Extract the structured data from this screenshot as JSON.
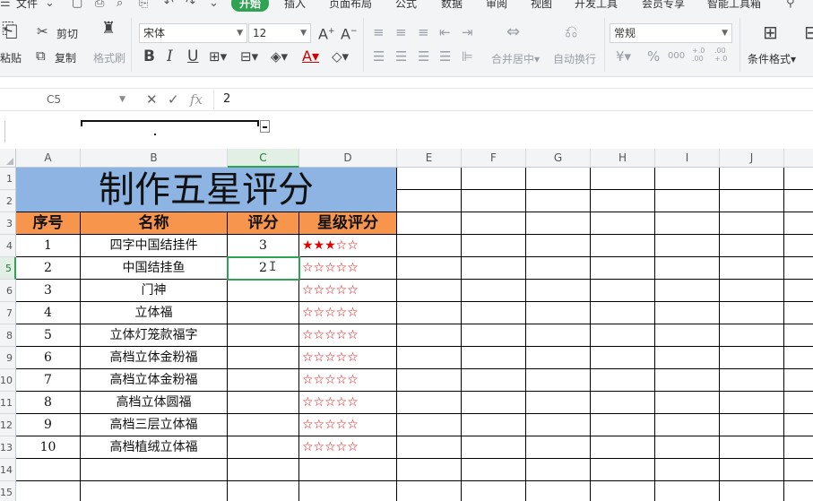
{
  "menu": {
    "file": "文件",
    "tabs": [
      "开始",
      "插入",
      "页面布局",
      "公式",
      "数据",
      "审阅",
      "视图",
      "开发工具",
      "会员专享",
      "智能工具箱"
    ],
    "active_tab": "开始"
  },
  "ribbon": {
    "paste": "粘贴",
    "cut": "剪切",
    "copy": "复制",
    "format_painter": "格式刷",
    "font_name": "宋体",
    "font_size": "12",
    "merge_center": "合并居中",
    "wrap_text": "自动换行",
    "number_format": "常规",
    "conditional_format": "条件格式",
    "currency_symbol": "¥",
    "percent_symbol": "%",
    "thousands": "000",
    "inc_decimal": "+.0 .00",
    "dec_decimal": ".00 +.0"
  },
  "formula_bar": {
    "name_box": "C5",
    "fx": "fx",
    "value": "2"
  },
  "sheet": {
    "columns": [
      "A",
      "B",
      "C",
      "D",
      "E",
      "F",
      "G",
      "H",
      "I",
      "J"
    ],
    "row_numbers": [
      "1",
      "2",
      "3",
      "4",
      "5",
      "6",
      "7",
      "8",
      "9",
      "10",
      "11",
      "12",
      "13",
      "14",
      "15"
    ],
    "selected_column": "C",
    "selected_row": "5",
    "title": "制作五星评分",
    "headers": [
      "序号",
      "名称",
      "评分",
      "星级评分"
    ],
    "rows": [
      {
        "no": "1",
        "name": "四字中国结挂件",
        "score": "3",
        "stars": "★★★☆☆",
        "filled_stars": 3
      },
      {
        "no": "2",
        "name": "中国结挂鱼",
        "score": "2",
        "stars": "☆☆☆☆☆",
        "filled_stars": 0
      },
      {
        "no": "3",
        "name": "门神",
        "score": "",
        "stars": "☆☆☆☆☆",
        "filled_stars": 0
      },
      {
        "no": "4",
        "name": "立体福",
        "score": "",
        "stars": "☆☆☆☆☆",
        "filled_stars": 0
      },
      {
        "no": "5",
        "name": "立体灯笼款福字",
        "score": "",
        "stars": "☆☆☆☆☆",
        "filled_stars": 0
      },
      {
        "no": "6",
        "name": "高档立体金粉福",
        "score": "",
        "stars": "☆☆☆☆☆",
        "filled_stars": 0
      },
      {
        "no": "7",
        "name": "高档立体金粉福",
        "score": "",
        "stars": "☆☆☆☆☆",
        "filled_stars": 0
      },
      {
        "no": "8",
        "name": "高档立体圆福",
        "score": "",
        "stars": "☆☆☆☆☆",
        "filled_stars": 0
      },
      {
        "no": "9",
        "name": "高档三层立体福",
        "score": "",
        "stars": "☆☆☆☆☆",
        "filled_stars": 0
      },
      {
        "no": "10",
        "name": "高档植绒立体福",
        "score": "",
        "stars": "☆☆☆☆☆",
        "filled_stars": 0
      }
    ]
  },
  "colors": {
    "title_fill": "#8eb4e3",
    "header_fill": "#f6954b",
    "star_color": "#e60000",
    "active_green": "#2fa351"
  }
}
